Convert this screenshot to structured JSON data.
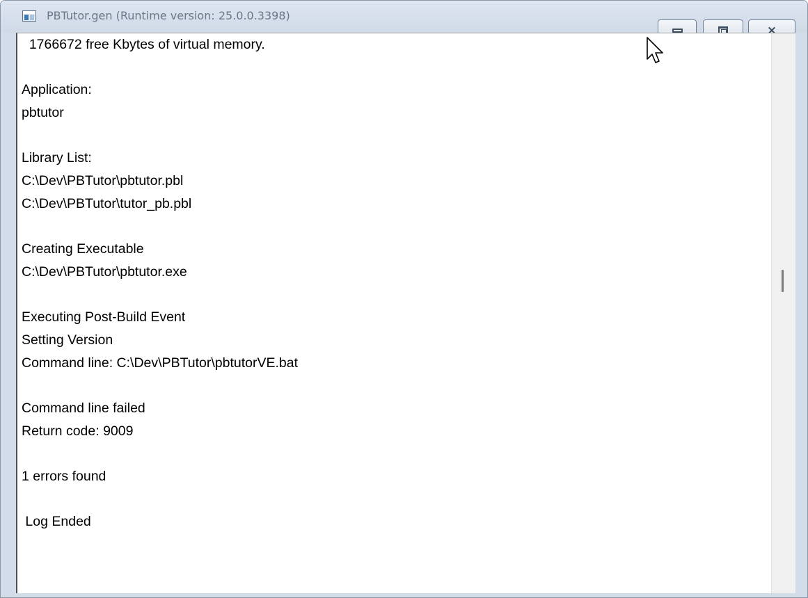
{
  "window": {
    "title": "PBTutor.gen (Runtime version: 25.0.0.3398)",
    "icon": "window-app-icon",
    "controls": {
      "minimize": "minimize-icon",
      "maximize": "restore-icon",
      "close_glyph": "⨯"
    }
  },
  "log": {
    "lines": [
      "  1766672 free Kbytes of virtual memory.",
      "",
      "Application:",
      "pbtutor",
      "",
      "Library List:",
      "C:\\Dev\\PBTutor\\pbtutor.pbl",
      "C:\\Dev\\PBTutor\\tutor_pb.pbl",
      "",
      "Creating Executable",
      "C:\\Dev\\PBTutor\\pbtutor.exe",
      "",
      "Executing Post-Build Event",
      "Setting Version",
      "Command line: C:\\Dev\\PBTutor\\pbtutorVE.bat",
      "",
      "Command line failed",
      "Return code: 9009",
      "",
      "1 errors found",
      "",
      " Log Ended"
    ]
  },
  "colors": {
    "title_text": "#6b7785",
    "frame": "#d3dde9",
    "content_bg": "#ffffff"
  }
}
